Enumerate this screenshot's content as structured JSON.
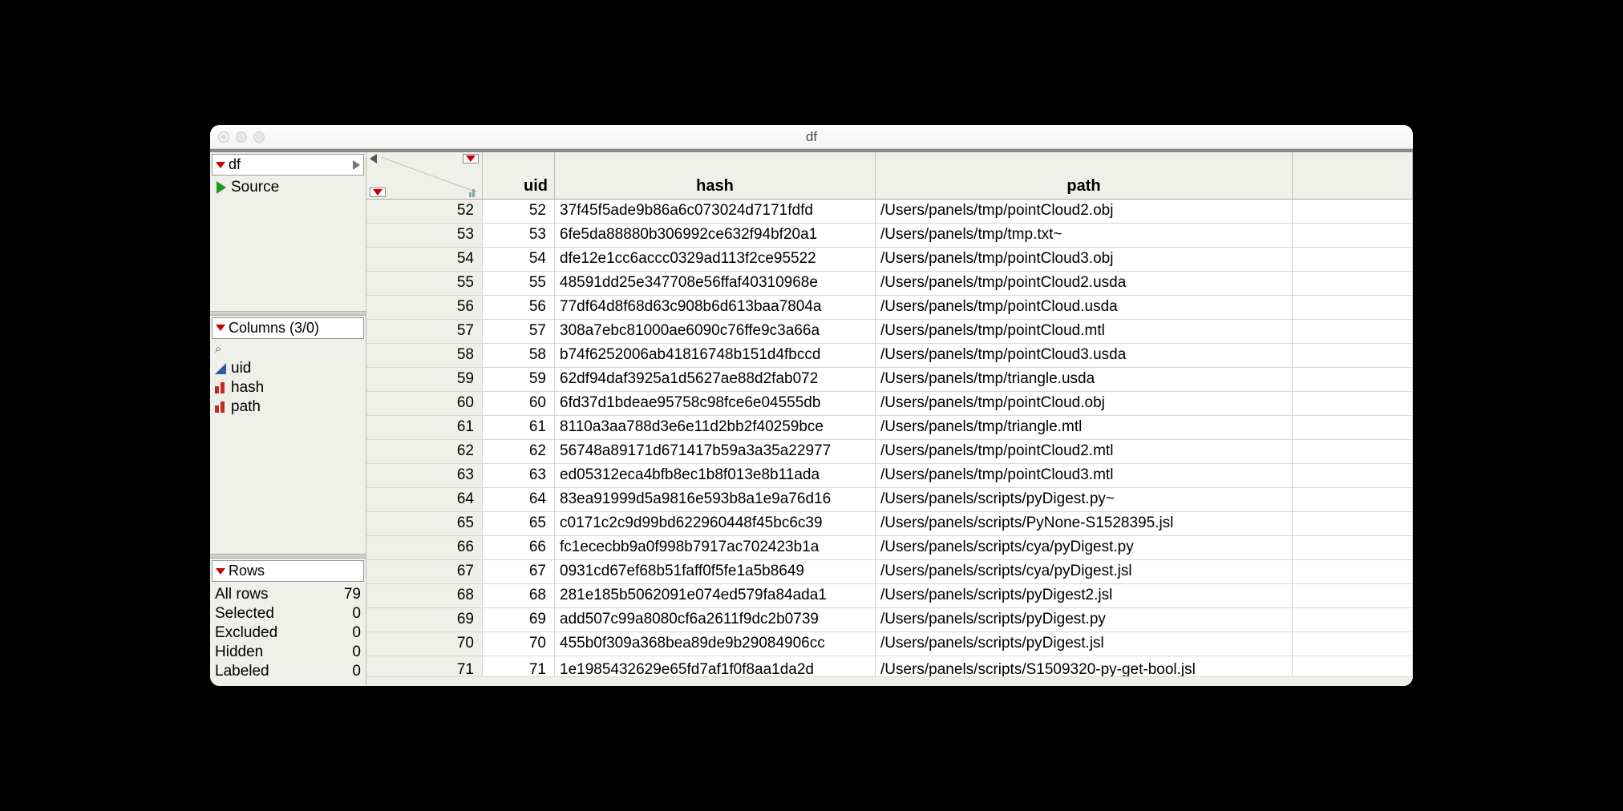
{
  "window": {
    "title": "df"
  },
  "sidebar": {
    "table_name": "df",
    "source_label": "Source",
    "columns_header": "Columns (3/0)",
    "columns": [
      {
        "name": "uid",
        "icon": "tri-blue"
      },
      {
        "name": "hash",
        "icon": "bars-red"
      },
      {
        "name": "path",
        "icon": "bars-red"
      }
    ],
    "rows_header": "Rows",
    "row_stats": [
      {
        "label": "All rows",
        "value": "79"
      },
      {
        "label": "Selected",
        "value": "0"
      },
      {
        "label": "Excluded",
        "value": "0"
      },
      {
        "label": "Hidden",
        "value": "0"
      },
      {
        "label": "Labeled",
        "value": "0"
      }
    ]
  },
  "grid": {
    "headers": {
      "uid": "uid",
      "hash": "hash",
      "path": "path"
    },
    "rows": [
      {
        "n": "52",
        "uid": "52",
        "hash": "37f45f5ade9b86a6c073024d7171fdfd",
        "path": "/Users/panels/tmp/pointCloud2.obj"
      },
      {
        "n": "53",
        "uid": "53",
        "hash": "6fe5da88880b306992ce632f94bf20a1",
        "path": "/Users/panels/tmp/tmp.txt~"
      },
      {
        "n": "54",
        "uid": "54",
        "hash": "dfe12e1cc6accc0329ad113f2ce95522",
        "path": "/Users/panels/tmp/pointCloud3.obj"
      },
      {
        "n": "55",
        "uid": "55",
        "hash": "48591dd25e347708e56ffaf40310968e",
        "path": "/Users/panels/tmp/pointCloud2.usda"
      },
      {
        "n": "56",
        "uid": "56",
        "hash": "77df64d8f68d63c908b6d613baa7804a",
        "path": "/Users/panels/tmp/pointCloud.usda"
      },
      {
        "n": "57",
        "uid": "57",
        "hash": "308a7ebc81000ae6090c76ffe9c3a66a",
        "path": "/Users/panels/tmp/pointCloud.mtl"
      },
      {
        "n": "58",
        "uid": "58",
        "hash": "b74f6252006ab41816748b151d4fbccd",
        "path": "/Users/panels/tmp/pointCloud3.usda"
      },
      {
        "n": "59",
        "uid": "59",
        "hash": "62df94daf3925a1d5627ae88d2fab072",
        "path": "/Users/panels/tmp/triangle.usda"
      },
      {
        "n": "60",
        "uid": "60",
        "hash": "6fd37d1bdeae95758c98fce6e04555db",
        "path": "/Users/panels/tmp/pointCloud.obj"
      },
      {
        "n": "61",
        "uid": "61",
        "hash": "8110a3aa788d3e6e11d2bb2f40259bce",
        "path": "/Users/panels/tmp/triangle.mtl"
      },
      {
        "n": "62",
        "uid": "62",
        "hash": "56748a89171d671417b59a3a35a22977",
        "path": "/Users/panels/tmp/pointCloud2.mtl"
      },
      {
        "n": "63",
        "uid": "63",
        "hash": "ed05312eca4bfb8ec1b8f013e8b11ada",
        "path": "/Users/panels/tmp/pointCloud3.mtl"
      },
      {
        "n": "64",
        "uid": "64",
        "hash": "83ea91999d5a9816e593b8a1e9a76d16",
        "path": "/Users/panels/scripts/pyDigest.py~"
      },
      {
        "n": "65",
        "uid": "65",
        "hash": "c0171c2c9d99bd622960448f45bc6c39",
        "path": "/Users/panels/scripts/PyNone-S1528395.jsl"
      },
      {
        "n": "66",
        "uid": "66",
        "hash": "fc1ececbb9a0f998b7917ac702423b1a",
        "path": "/Users/panels/scripts/cya/pyDigest.py"
      },
      {
        "n": "67",
        "uid": "67",
        "hash": "0931cd67ef68b51faff0f5fe1a5b8649",
        "path": "/Users/panels/scripts/cya/pyDigest.jsl"
      },
      {
        "n": "68",
        "uid": "68",
        "hash": "281e185b5062091e074ed579fa84ada1",
        "path": "/Users/panels/scripts/pyDigest2.jsl"
      },
      {
        "n": "69",
        "uid": "69",
        "hash": "add507c99a8080cf6a2611f9dc2b0739",
        "path": "/Users/panels/scripts/pyDigest.py"
      },
      {
        "n": "70",
        "uid": "70",
        "hash": "455b0f309a368bea89de9b29084906cc",
        "path": "/Users/panels/scripts/pyDigest.jsl"
      },
      {
        "n": "71",
        "uid": "71",
        "hash": "1e1985432629e65fd7af1f0f8aa1da2d",
        "path": "/Users/panels/scripts/S1509320-py-get-bool.jsl"
      }
    ]
  }
}
